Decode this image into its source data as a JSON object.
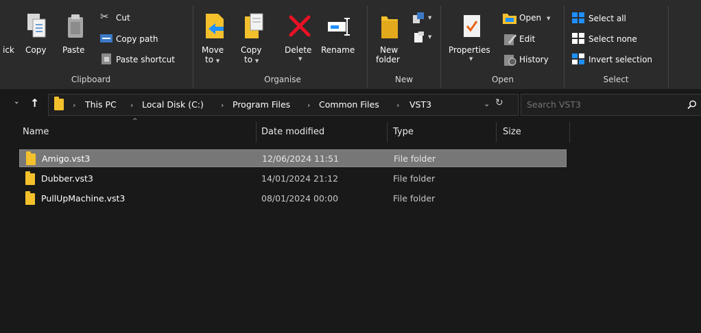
{
  "ribbon": {
    "clipboard": {
      "title": "Clipboard",
      "pin_label": "ick",
      "copy_label": "Copy",
      "paste_label": "Paste",
      "cut_label": "Cut",
      "copy_path_label": "Copy path",
      "paste_shortcut_label": "Paste shortcut"
    },
    "organise": {
      "title": "Organise",
      "move_to_line1": "Move",
      "move_to_line2": "to",
      "copy_to_line1": "Copy",
      "copy_to_line2": "to",
      "delete_label": "Delete",
      "rename_label": "Rename"
    },
    "new": {
      "title": "New",
      "new_folder_line1": "New",
      "new_folder_line2": "folder"
    },
    "open": {
      "title": "Open",
      "properties_label": "Properties",
      "open_label": "Open",
      "edit_label": "Edit",
      "history_label": "History"
    },
    "select": {
      "title": "Select",
      "select_all_label": "Select all",
      "select_none_label": "Select none",
      "invert_selection_label": "Invert selection"
    }
  },
  "address": {
    "crumbs": [
      "This PC",
      "Local Disk (C:)",
      "Program Files",
      "Common Files",
      "VST3"
    ],
    "search_placeholder": "Search VST3"
  },
  "columns": {
    "name": "Name",
    "date_modified": "Date modified",
    "type": "Type",
    "size": "Size"
  },
  "files": [
    {
      "name": "Amigo.vst3",
      "date": "12/06/2024 11:51",
      "type": "File folder",
      "size": ""
    },
    {
      "name": "Dubber.vst3",
      "date": "14/01/2024 21:12",
      "type": "File folder",
      "size": ""
    },
    {
      "name": "PullUpMachine.vst3",
      "date": "08/01/2024 00:00",
      "type": "File folder",
      "size": ""
    }
  ],
  "colors": {
    "ribbon_bg": "#2b2b2b",
    "content_bg": "#191919",
    "folder_yellow": "#f4c12d",
    "selection_bg": "#777777",
    "delete_red": "#e81123",
    "accent_blue": "#1e90ff"
  }
}
